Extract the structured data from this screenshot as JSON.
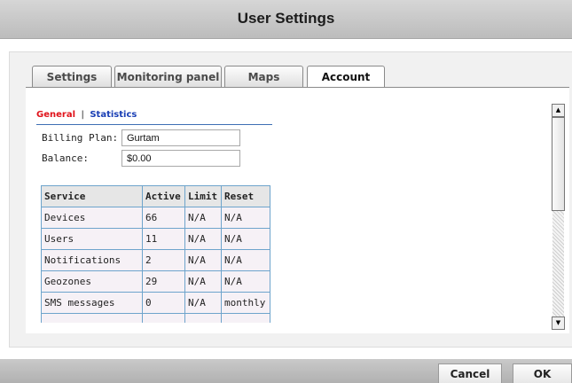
{
  "window": {
    "title": "User Settings"
  },
  "tabs": [
    {
      "label": "Settings",
      "active": false
    },
    {
      "label": "Monitoring panel",
      "active": false
    },
    {
      "label": "Maps",
      "active": false
    },
    {
      "label": "Account",
      "active": true
    }
  ],
  "subnav": {
    "general": "General",
    "separator": "|",
    "statistics": "Statistics"
  },
  "account": {
    "billing_plan_label": "Billing Plan:",
    "billing_plan_value": "Gurtam",
    "balance_label": "Balance:",
    "balance_value": "$0.00"
  },
  "services": {
    "headers": [
      "Service",
      "Active",
      "Limit",
      "Reset"
    ],
    "rows": [
      [
        "Devices",
        "66",
        "N/A",
        "N/A"
      ],
      [
        "Users",
        "11",
        "N/A",
        "N/A"
      ],
      [
        "Notifications",
        "2",
        "N/A",
        "N/A"
      ],
      [
        "Geozones",
        "29",
        "N/A",
        "N/A"
      ],
      [
        "SMS messages",
        "0",
        "N/A",
        "monthly"
      ]
    ]
  },
  "scrollbar": {
    "position": 0
  },
  "buttons": {
    "cancel": "Cancel",
    "ok": "OK"
  },
  "colors": {
    "general_link": "#e0121a",
    "statistics_link": "#1a3fb5",
    "table_border": "#6ea4cc",
    "table_cell_bg": "#f6f1f6"
  }
}
